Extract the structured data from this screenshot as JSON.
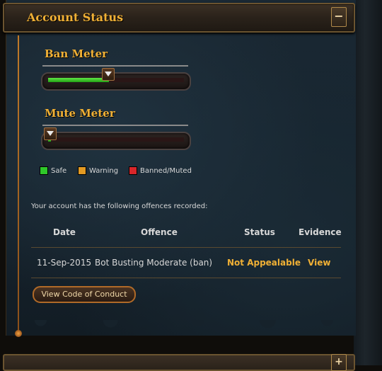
{
  "panel": {
    "title": "Account Status",
    "collapse_symbol": "−"
  },
  "meters": [
    {
      "label": "Ban Meter",
      "level_fraction": 0.45
    },
    {
      "label": "Mute Meter",
      "level_fraction": 0.02
    }
  ],
  "legend": [
    {
      "label": "Safe",
      "color": "#2fc82a"
    },
    {
      "label": "Warning",
      "color": "#e39a22"
    },
    {
      "label": "Banned/Muted",
      "color": "#d8262a"
    }
  ],
  "offences": {
    "intro": "Your account has the following offences recorded:",
    "columns": [
      "Date",
      "Offence",
      "Status",
      "Evidence"
    ],
    "rows": [
      {
        "date": "11-Sep-2015",
        "offence": "Bot Busting Moderate (ban)",
        "status": "Not Appealable",
        "evidence": "View"
      }
    ]
  },
  "buttons": {
    "code_of_conduct": "View Code of Conduct"
  },
  "second_panel": {
    "expand_symbol": "+"
  },
  "colors": {
    "accent": "#f0b035",
    "panel_bg": "#1a2833"
  }
}
